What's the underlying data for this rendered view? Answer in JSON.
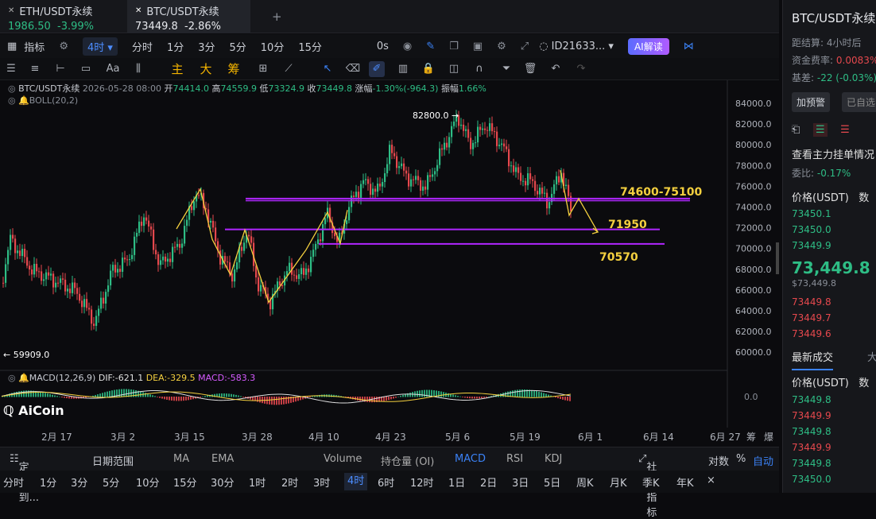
{
  "tabs": [
    {
      "name": "ETH/USDT永续",
      "price": "1986.50",
      "change": "-3.99%",
      "active": false
    },
    {
      "name": "BTC/USDT永续",
      "price": "73449.8",
      "change": "-2.86%",
      "active": true
    }
  ],
  "add_tab": "+",
  "toolbar": {
    "indicator": "指标",
    "interval": "4时",
    "intervals": [
      "分时",
      "1分",
      "3分",
      "5分",
      "10分",
      "15分"
    ],
    "speed": "0s",
    "account": "ID21633...",
    "ai": "AI解读"
  },
  "drawbar": {
    "main": "主",
    "big": "大",
    "chip": "筹",
    "text": "Aa"
  },
  "ohlc": {
    "symbol": "BTC/USDT永续",
    "datetime": "2026-05-28 08:00",
    "open_label": "开",
    "open": "74414.0",
    "high_label": "高",
    "high": "74559.9",
    "low_label": "低",
    "low": "73324.9",
    "close_label": "收",
    "close": "73449.8",
    "change_label": "涨幅",
    "change": "-1.30%(-964.3)",
    "amp_label": "振幅",
    "amp": "1.66%"
  },
  "boll": "BOLL(20,2)",
  "macd": {
    "label": "MACD(12,26,9)",
    "dif": "DIF:-621.1",
    "dea": "DEA:-329.5",
    "macd": "MACD:-583.3"
  },
  "annotations": {
    "high": "82800.0 →",
    "low": "← 59909.0",
    "zone": "74600-75100",
    "level1": "71950",
    "level2": "70570"
  },
  "price_axis": [
    "84000.0",
    "82000.0",
    "80000.0",
    "78000.0",
    "76000.0",
    "74000.0",
    "72000.0",
    "70000.0",
    "68000.0",
    "66000.0",
    "64000.0",
    "62000.0",
    "60000.0"
  ],
  "macd_axis": "0.0",
  "x_axis": [
    "2月 17",
    "3月 2",
    "3月 15",
    "3月 28",
    "4月 10",
    "4月 23",
    "5月 6",
    "5月 19",
    "6月 1",
    "6月 14",
    "6月 27",
    "筹",
    "爆"
  ],
  "watermark": "AiCoin",
  "indicator_bar": {
    "locate": "定位到...",
    "range": "日期范围",
    "items": [
      "MA",
      "EMA",
      "Volume",
      "持仓量 (OI)",
      "MACD",
      "RSI",
      "KDJ"
    ],
    "active": "MACD",
    "community": "社区指标",
    "log": "对数",
    "pct": "%",
    "auto": "自动"
  },
  "timeframes": [
    "分时",
    "1分",
    "3分",
    "5分",
    "10分",
    "15分",
    "30分",
    "1时",
    "2时",
    "3时",
    "4时",
    "6时",
    "12时",
    "1日",
    "2日",
    "3日",
    "5日",
    "周K",
    "月K",
    "季K",
    "年K"
  ],
  "timeframe_active": "4时",
  "side": {
    "title": "BTC/USDT永续",
    "settle_label": "距结算:",
    "settle": "4小时后",
    "funding_label": "资金费率:",
    "funding": "0.0083%",
    "basis_label": "基差:",
    "basis": "-22 (-0.03%)",
    "alert": "加预警",
    "fav": "已自选",
    "orders_title": "查看主力挂单情况",
    "ratio_label": "委比:",
    "ratio": "-0.17%",
    "price_header": "价格(USDT)",
    "qty_header": "数",
    "asks": [
      "73450.1",
      "73450.0",
      "73449.9"
    ],
    "last": "73,449.8",
    "last_usd": "$73,449.8",
    "bids": [
      "73449.8",
      "73449.7",
      "73449.6"
    ],
    "trades_title": "最新成交",
    "trades_tab2": "大",
    "trades": [
      {
        "p": "73449.8",
        "c": "#2ebd85"
      },
      {
        "p": "73449.9",
        "c": "#e5484d"
      },
      {
        "p": "73449.8",
        "c": "#2ebd85"
      },
      {
        "p": "73449.9",
        "c": "#e5484d"
      },
      {
        "p": "73449.8",
        "c": "#2ebd85"
      },
      {
        "p": "73450.0",
        "c": "#2ebd85"
      }
    ]
  },
  "colors": {
    "up": "#2ebd85",
    "down": "#e5484d",
    "accent": "#3b82f6",
    "level": "#b026ff",
    "note": "#f4d03f"
  }
}
